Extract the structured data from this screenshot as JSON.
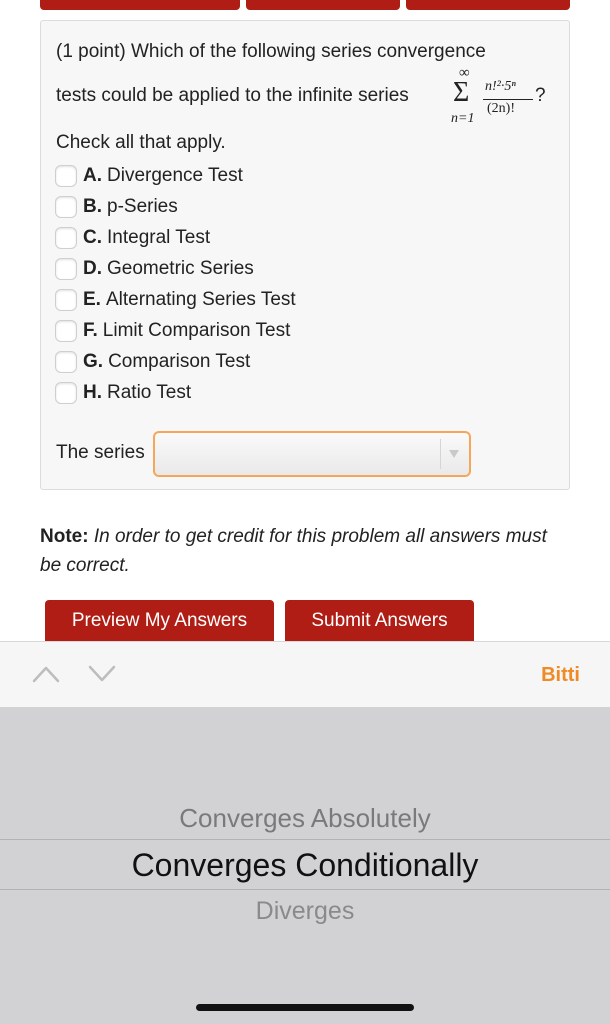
{
  "question": {
    "line1": "(1 point) Which of the following series convergence",
    "line2": "tests could be applied to the infinite series",
    "sum_upper": "∞",
    "sum_lower": "n=1",
    "numerator": "n!²·5ⁿ",
    "denominator": "(2n)!",
    "qmark": "?",
    "check_all": "Check all that apply."
  },
  "options": [
    {
      "letter": "A.",
      "text": "Divergence Test"
    },
    {
      "letter": "B.",
      "text": "p-Series"
    },
    {
      "letter": "C.",
      "text": "Integral Test"
    },
    {
      "letter": "D.",
      "text": "Geometric Series"
    },
    {
      "letter": "E.",
      "text": "Alternating Series Test"
    },
    {
      "letter": "F.",
      "text": "Limit Comparison Test"
    },
    {
      "letter": "G.",
      "text": "Comparison Test"
    },
    {
      "letter": "H.",
      "text": "Ratio Test"
    }
  ],
  "series_select": {
    "label": "The series",
    "value": ""
  },
  "note": {
    "bold": "Note:",
    "text": "In order to get credit for this problem all answers must be correct."
  },
  "buttons": {
    "preview": "Preview My Answers",
    "submit": "Submit Answers"
  },
  "toolbar": {
    "done": "Bitti",
    "done_color": "#ef8a24"
  },
  "picker": {
    "above": "Converges Absolutely",
    "selected": "Converges Conditionally",
    "below": "Diverges"
  },
  "colors": {
    "button": "#b01d15",
    "select_border": "#f5a65b"
  }
}
